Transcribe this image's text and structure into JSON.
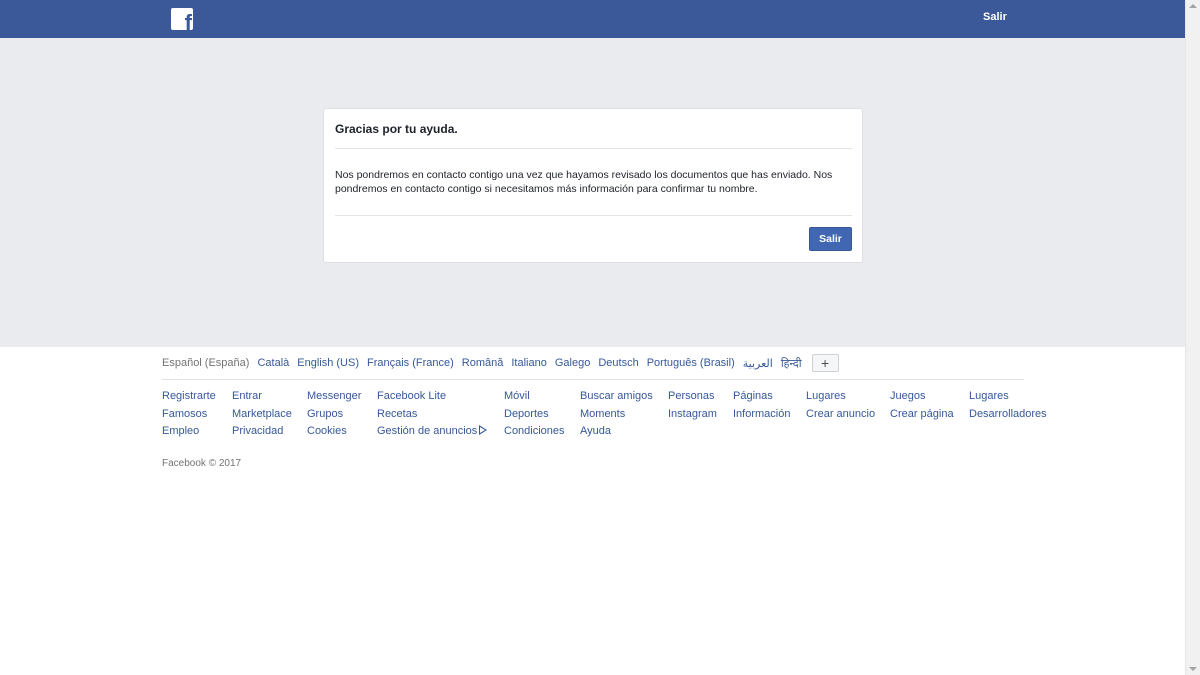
{
  "header": {
    "logo_letter": "f",
    "logout_label": "Salir",
    "bar_color": "#3b5998"
  },
  "card": {
    "title": "Gracias por tu ayuda.",
    "body": "Nos pondremos en contacto contigo una vez que hayamos revisado los documentos que has enviado. Nos pondremos en contacto contigo si necesitamos más información para confirmar tu nombre.",
    "button_label": "Salir"
  },
  "footer": {
    "languages": [
      "Español (España)",
      "Català",
      "English (US)",
      "Français (France)",
      "Română",
      "Italiano",
      "Galego",
      "Deutsch",
      "Português (Brasil)",
      "العربية",
      "हिन्दी"
    ],
    "more_languages_label": "+",
    "link_columns": [
      [
        "Registrarte",
        "Famosos",
        "Empleo"
      ],
      [
        "Entrar",
        "Marketplace",
        "Privacidad"
      ],
      [
        "Messenger",
        "Grupos",
        "Cookies"
      ],
      [
        "Facebook Lite",
        "Recetas",
        "Gestión de anuncios"
      ],
      [
        "Móvil",
        "Deportes",
        "Condiciones"
      ],
      [
        "Buscar amigos",
        "Moments",
        "Ayuda"
      ],
      [
        "Personas",
        "Instagram"
      ],
      [
        "Páginas",
        "Información"
      ],
      [
        "Lugares",
        "Crear anuncio"
      ],
      [
        "Juegos",
        "Crear página"
      ],
      [
        "Lugares",
        "Desarrolladores"
      ]
    ],
    "copyright": "Facebook © 2017"
  },
  "colors": {
    "accent": "#4267b2",
    "link": "#365899",
    "background": "#e9ebee"
  }
}
